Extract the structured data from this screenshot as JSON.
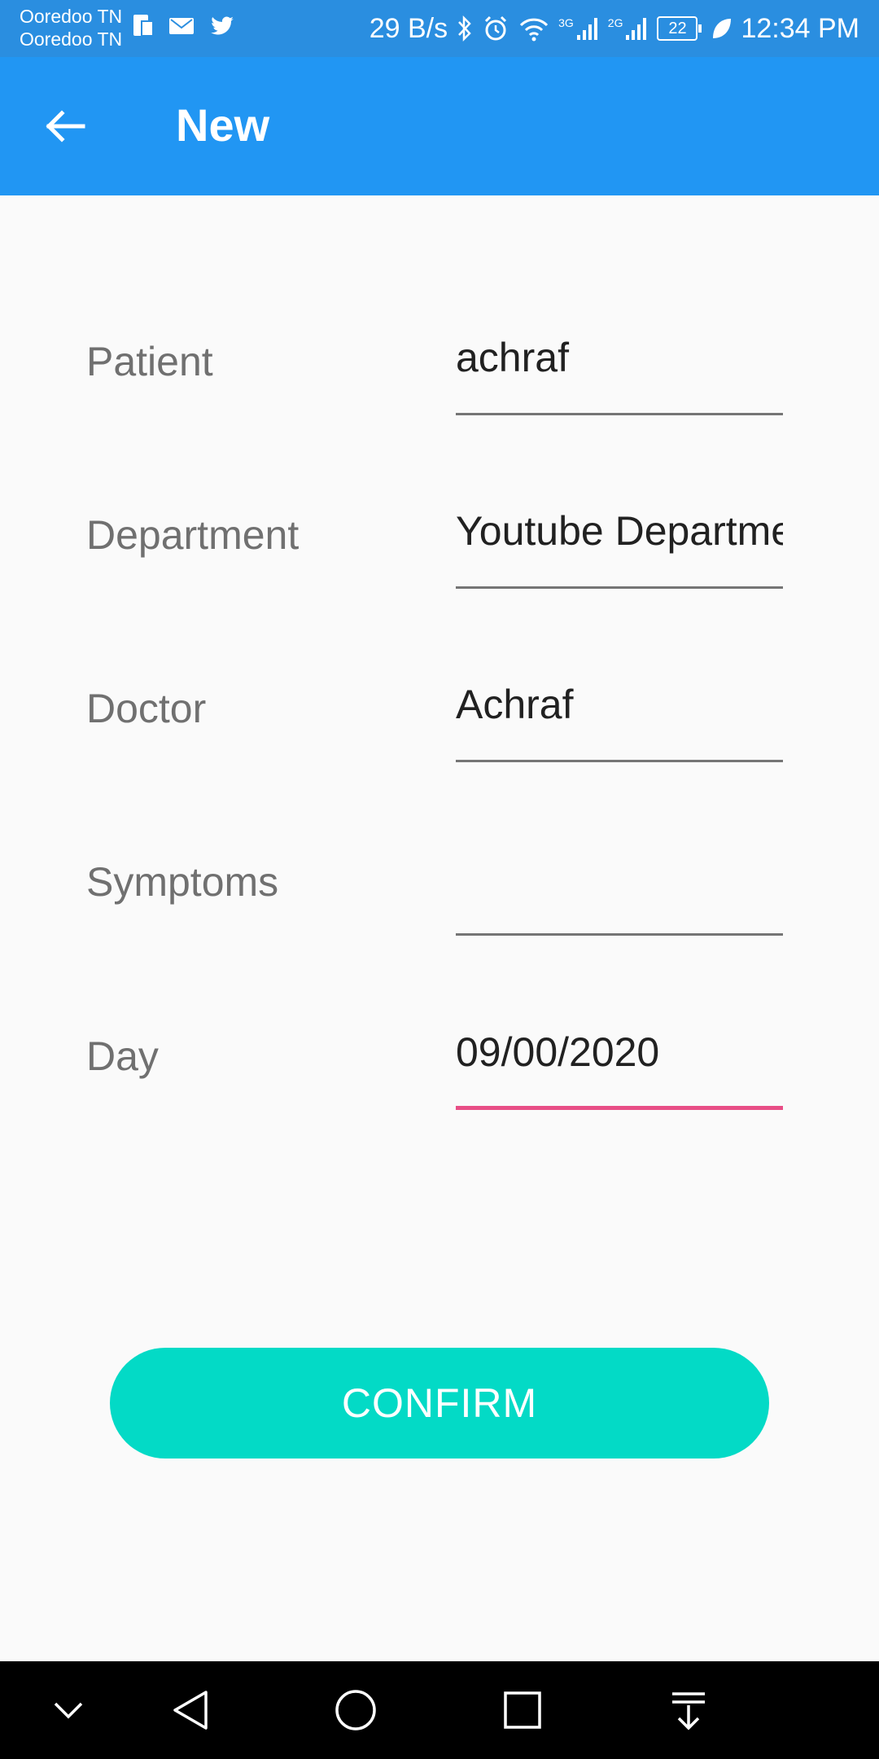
{
  "status_bar": {
    "carrier_1": "Ooredoo TN",
    "carrier_2": "Ooredoo TN",
    "net_speed": "29 B/s",
    "net_3g": "3G",
    "net_2g": "2G",
    "battery": "22",
    "time": "12:34 PM"
  },
  "app_bar": {
    "title": "New"
  },
  "form": {
    "fields": [
      {
        "label": "Patient",
        "value": "achraf"
      },
      {
        "label": "Department",
        "value": "Youtube Department"
      },
      {
        "label": "Doctor",
        "value": "Achraf"
      },
      {
        "label": "Symptoms",
        "value": ""
      },
      {
        "label": "Day",
        "value": "09/00/2020"
      }
    ]
  },
  "confirm_label": "CONFIRM",
  "colors": {
    "status_bar": "#2a8ee0",
    "app_bar": "#2196f3",
    "button": "#03dac6",
    "focus_line": "#e84e86"
  }
}
